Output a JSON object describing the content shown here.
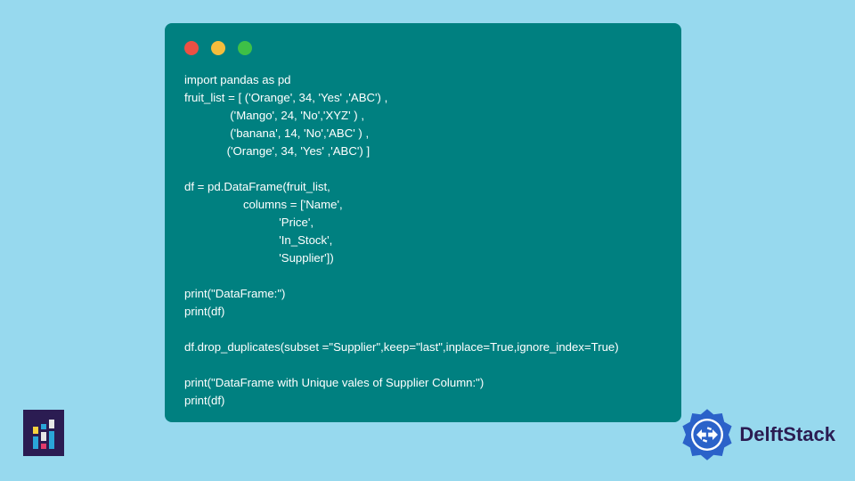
{
  "window": {
    "traffic": {
      "red": "#ec5044",
      "yellow": "#f5bd3c",
      "green": "#3ec047"
    },
    "background": "teal"
  },
  "code": {
    "lines": [
      "import pandas as pd",
      "fruit_list = [ ('Orange', 34, 'Yes' ,'ABC') ,",
      "              ('Mango', 24, 'No','XYZ' ) ,",
      "              ('banana', 14, 'No','ABC' ) ,",
      "             ('Orange', 34, 'Yes' ,'ABC') ]",
      "",
      "df = pd.DataFrame(fruit_list,",
      "                  columns = ['Name',",
      "                             'Price',",
      "                             'In_Stock',",
      "                             'Supplier'])",
      "",
      "print(\"DataFrame:\")",
      "print(df)",
      "",
      "df.drop_duplicates(subset =\"Supplier\",keep=\"last\",inplace=True,ignore_index=True)",
      "",
      "print(\"DataFrame with Unique vales of Supplier Column:\")",
      "print(df)"
    ]
  },
  "brand": {
    "name": "DelftStack",
    "color": "#2b1c52",
    "accent": "#2b62c9"
  }
}
